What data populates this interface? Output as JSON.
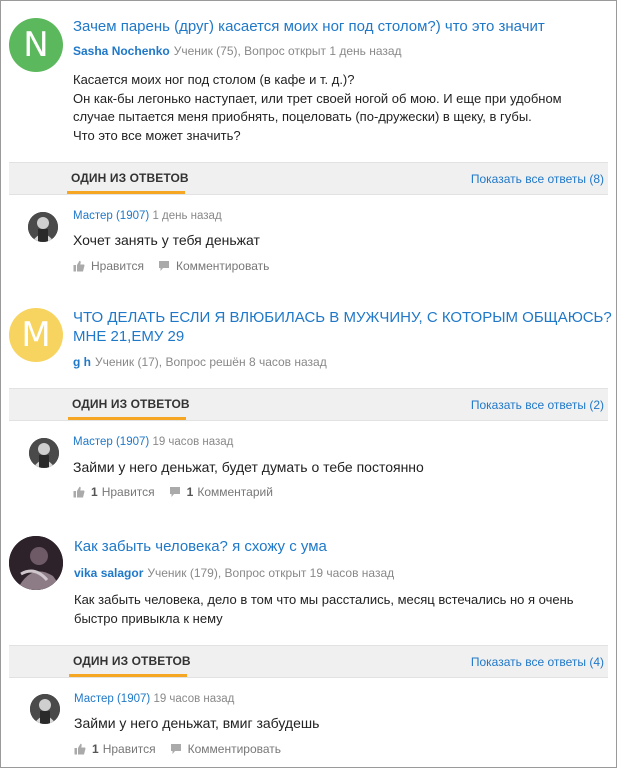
{
  "questions": [
    {
      "avatar_letter": "N",
      "avatar_color": "#5cb85c",
      "title": "Зачем парень (друг) касается моих ног под столом?) что это значит",
      "author": "Sasha Nochenko",
      "meta": "Ученик (75), Вопрос открыт 1 день назад",
      "body": [
        "Касается моих ног под столом (в кафе и т. д.)?",
        "Он как-бы легонько наступает, или трет своей ногой об мою. И еще при удобном",
        "случае пытается меня приобнять, поцеловать (по-дружески) в щеку, в губы.",
        "Что это все может значить?"
      ],
      "answers_label": "ОДИН ИЗ ОТВЕТОВ",
      "show_all": "Показать все ответы (8)",
      "answer": {
        "author": "Мастер (1907)",
        "time": "1 день назад",
        "text": "Хочет занять у тебя деньжат",
        "like_count": "",
        "like_label": "Нравится",
        "comment_count": "",
        "comment_label": "Комментировать"
      }
    },
    {
      "avatar_letter": "M",
      "avatar_color": "#f7d45f",
      "title_lines": [
        "ЧТО ДЕЛАТЬ ЕСЛИ Я ВЛЮБИЛАСЬ В МУЖЧИНУ, С КОТОРЫМ ОБЩАЮСЬ?",
        "МНЕ 21,ЕМУ 29"
      ],
      "author": "g h",
      "meta": "Ученик (17), Вопрос решён 8 часов назад",
      "answers_label": "ОДИН ИЗ ОТВЕТОВ",
      "show_all": "Показать все ответы (2)",
      "answer": {
        "author": "Мастер (1907)",
        "time": "19 часов назад",
        "text": "Займи у него деньжат, будет думать о тебе постоянно",
        "like_count": "1",
        "like_label": "Нравится",
        "comment_count": "1",
        "comment_label": "Комментарий"
      }
    },
    {
      "avatar_color": "#2a1f26",
      "title": "Как забыть человека? я схожу с ума",
      "author": "vika salagor",
      "meta": "Ученик (179), Вопрос открыт 19 часов назад",
      "body": [
        "Как забыть человека, дело в том что мы расстались, месяц встечались но я очень",
        "быстро привыкла к нему"
      ],
      "answers_label": "ОДИН ИЗ ОТВЕТОВ",
      "show_all": "Показать все ответы (4)",
      "answer": {
        "author": "Мастер (1907)",
        "time": "19 часов назад",
        "text": "Займи у него деньжат, вмиг забудешь",
        "like_count": "1",
        "like_label": "Нравится",
        "comment_count": "",
        "comment_label": "Комментировать"
      }
    }
  ]
}
